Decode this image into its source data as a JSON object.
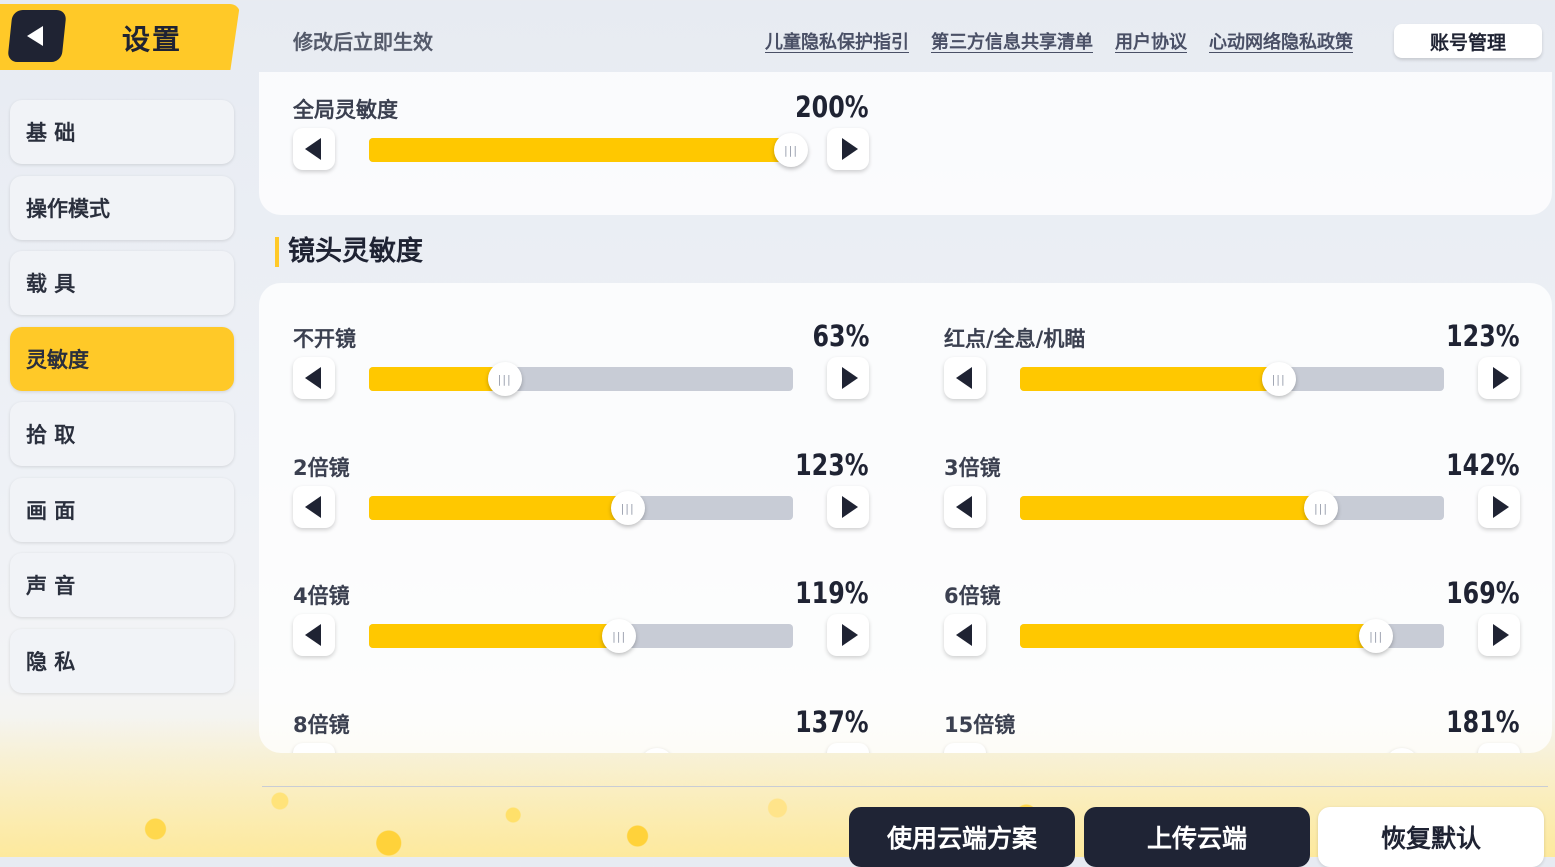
{
  "header": {
    "title": "设置",
    "hint": "修改后立即生效",
    "links": [
      "儿童隐私保护指引",
      "第三方信息共享清单",
      "用户协议",
      "心动网络隐私政策"
    ],
    "account_button": "账号管理"
  },
  "sidebar": {
    "items": [
      {
        "label": "基 础"
      },
      {
        "label": "操作模式"
      },
      {
        "label": "载 具"
      },
      {
        "label": "灵敏度",
        "active": true
      },
      {
        "label": "拾 取"
      },
      {
        "label": "画 面"
      },
      {
        "label": "声 音"
      },
      {
        "label": "隐 私"
      }
    ]
  },
  "global": {
    "label": "全局灵敏度",
    "value": "200%",
    "fill_fraction": 1.0
  },
  "section": {
    "title": "镜头灵敏度"
  },
  "settings": [
    {
      "label": "不开镜",
      "value": "63%",
      "fill_fraction": 0.32
    },
    {
      "label": "红点/全息/机瞄",
      "value": "123%",
      "fill_fraction": 0.61
    },
    {
      "label": "2倍镜",
      "value": "123%",
      "fill_fraction": 0.61
    },
    {
      "label": "3倍镜",
      "value": "142%",
      "fill_fraction": 0.71
    },
    {
      "label": "4倍镜",
      "value": "119%",
      "fill_fraction": 0.59
    },
    {
      "label": "6倍镜",
      "value": "169%",
      "fill_fraction": 0.84
    },
    {
      "label": "8倍镜",
      "value": "137%",
      "fill_fraction": 0.68
    },
    {
      "label": "15倍镜",
      "value": "181%",
      "fill_fraction": 0.9
    }
  ],
  "bottom_buttons": {
    "use_cloud": "使用云端方案",
    "upload_cloud": "上传云端",
    "restore_default": "恢复默认"
  },
  "colors": {
    "accent": "#ffc928",
    "slider_fill": "#ffc800",
    "dark": "#1f2333"
  }
}
